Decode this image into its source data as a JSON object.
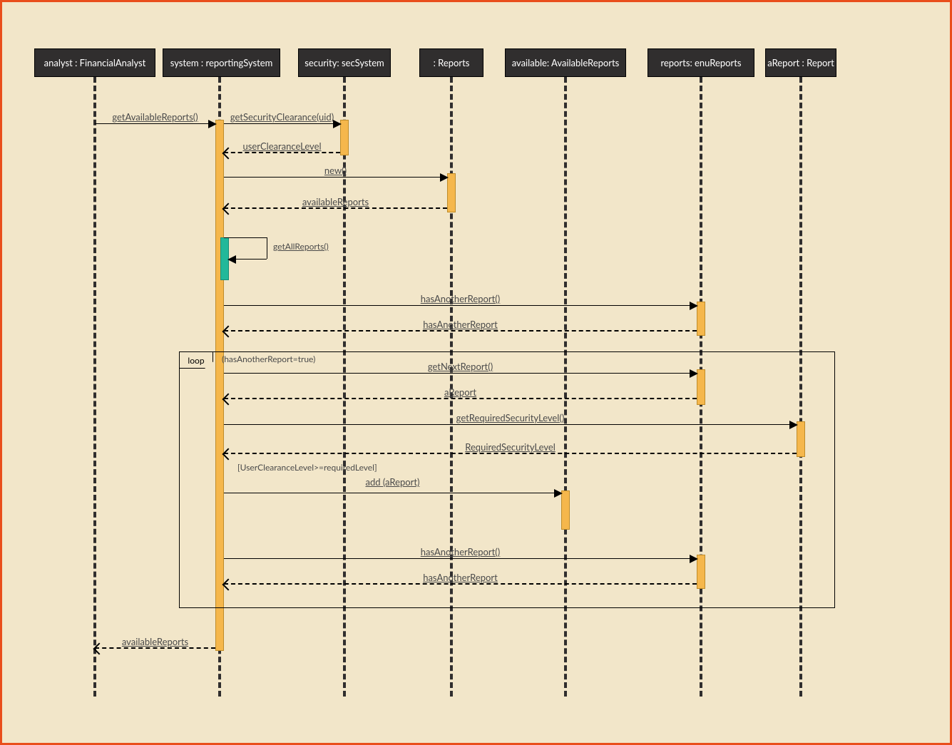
{
  "participants": {
    "analyst": "analyst : FinancialAnalyst",
    "system": "system : reportingSystem",
    "security": "security: secSystem",
    "reports": ": Reports",
    "available": "available: AvailableReports",
    "enuReports": "reports: enuReports",
    "aReport": "aReport : Report"
  },
  "messages": {
    "m1": "getAvailableReports()",
    "m2": "getSecurityClearance(uid)",
    "m3": "userClearanceLevel",
    "m4": "new()",
    "m5": "availableReports",
    "m6": "getAllReports()",
    "m7": "hasAnotherReport()",
    "m8": "hasAnotherReport",
    "m9": "getNextReport()",
    "m10": "aReport",
    "m11": "getRequiredSecurityLevel()",
    "m12": "RequiredSecurityLevel",
    "m13guard": "[UserClearanceLevel>=requiredLevel]",
    "m13": "add (aReport)",
    "m14": "hasAnotherReport()",
    "m15": "hasAnotherReport",
    "m16": "availableReports"
  },
  "loop": {
    "label": "loop",
    "condition": "(hasAnotherReport=true)"
  }
}
